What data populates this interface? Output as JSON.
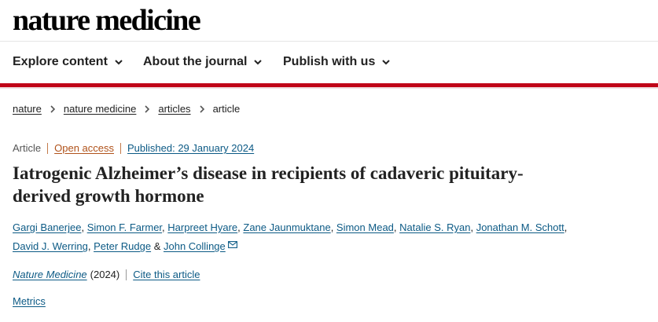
{
  "header": {
    "logo_text": "nature medicine"
  },
  "nav": {
    "items": [
      {
        "label": "Explore content",
        "icon": "chevron-down-icon"
      },
      {
        "label": "About the journal",
        "icon": "chevron-down-icon"
      },
      {
        "label": "Publish with us",
        "icon": "chevron-down-icon"
      }
    ],
    "accent_color": "#c00418"
  },
  "breadcrumb": {
    "items": [
      "nature",
      "nature medicine",
      "articles"
    ],
    "current": "article",
    "separator_icon": "chevron-right-icon"
  },
  "article": {
    "type": "Article",
    "access": "Open access",
    "published": "Published: 29 January 2024",
    "title": "Iatrogenic Alzheimer’s disease in recipients of cadaveric pituitary-derived growth hormone",
    "authors": [
      "Gargi Banerjee",
      "Simon F. Farmer",
      "Harpreet Hyare",
      "Zane Jaunmuktane",
      "Simon Mead",
      "Natalie S. Ryan",
      "Jonathan M. Schott",
      "David J. Werring",
      "Peter Rudge",
      "John Collinge"
    ],
    "author_separator": ", ",
    "author_last_separator": " & ",
    "corresponding_icon": "envelope-icon",
    "journal": "Nature Medicine",
    "year": "(2024)",
    "cite_label": "Cite this article",
    "metrics_label": "Metrics"
  },
  "colors": {
    "link": "#0c5a85",
    "open_access": "#b0521a",
    "rule": "#c00418"
  }
}
